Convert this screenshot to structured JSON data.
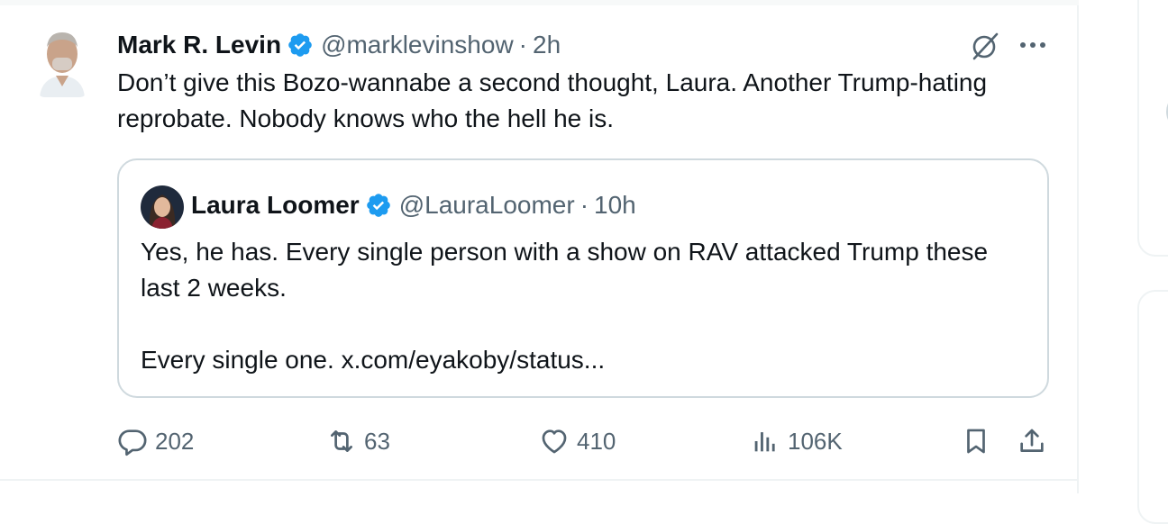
{
  "tweet": {
    "author_name": "Mark R. Levin",
    "handle": "@marklevinshow",
    "separator": "·",
    "time": "2h",
    "text": "Don’t give this Bozo-wannabe a second thought, Laura. Another Trump-hating reprobate. Nobody knows who the hell he is.",
    "quote": {
      "author_name": "Laura Loomer",
      "handle": "@LauraLoomer",
      "separator": "·",
      "time": "10h",
      "line1": "Yes, he has. Every single person with a show on RAV attacked Trump these last 2 weeks.",
      "line2": "Every single one. x.com/eyakoby/status..."
    },
    "actions": {
      "replies": "202",
      "reposts": "63",
      "likes": "410",
      "views": "106K"
    }
  },
  "icons": {
    "verified": "verified-badge-icon",
    "grok": "grok-icon",
    "more": "more-icon",
    "reply": "reply-icon",
    "repost": "repost-icon",
    "like": "heart-icon",
    "views": "views-icon",
    "bookmark": "bookmark-icon",
    "share": "share-icon"
  },
  "colors": {
    "verified": "#1d9bf0",
    "secondary_text": "#536471",
    "border": "#cfd9de"
  }
}
